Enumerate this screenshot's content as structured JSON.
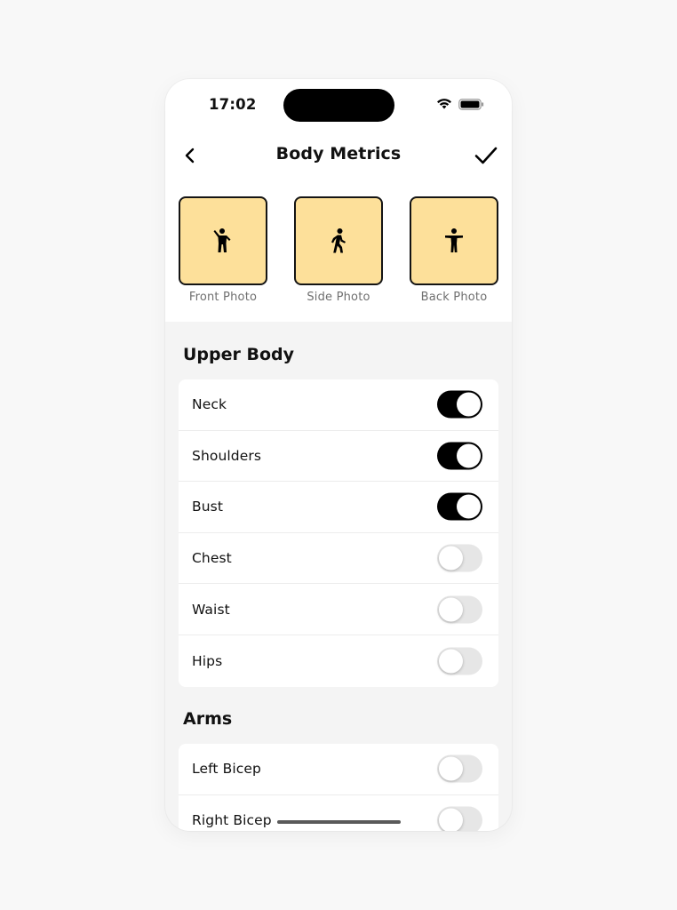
{
  "status_bar": {
    "time": "17:02"
  },
  "header": {
    "title": "Body Metrics"
  },
  "photos": [
    {
      "label": "Front Photo",
      "icon": "person-arms-up-icon"
    },
    {
      "label": "Side Photo",
      "icon": "person-walking-icon"
    },
    {
      "label": "Back Photo",
      "icon": "person-arms-out-icon"
    }
  ],
  "sections": [
    {
      "title": "Upper Body",
      "items": [
        {
          "label": "Neck",
          "on": true
        },
        {
          "label": "Shoulders",
          "on": true
        },
        {
          "label": "Bust",
          "on": true
        },
        {
          "label": "Chest",
          "on": false
        },
        {
          "label": "Waist",
          "on": false
        },
        {
          "label": "Hips",
          "on": false
        }
      ]
    },
    {
      "title": "Arms",
      "items": [
        {
          "label": "Left Bicep",
          "on": false
        },
        {
          "label": "Right Bicep",
          "on": false
        }
      ]
    }
  ],
  "colors": {
    "photo_bg": "#fde09a",
    "toggle_on": "#000000",
    "toggle_off": "#e6e6e6"
  }
}
